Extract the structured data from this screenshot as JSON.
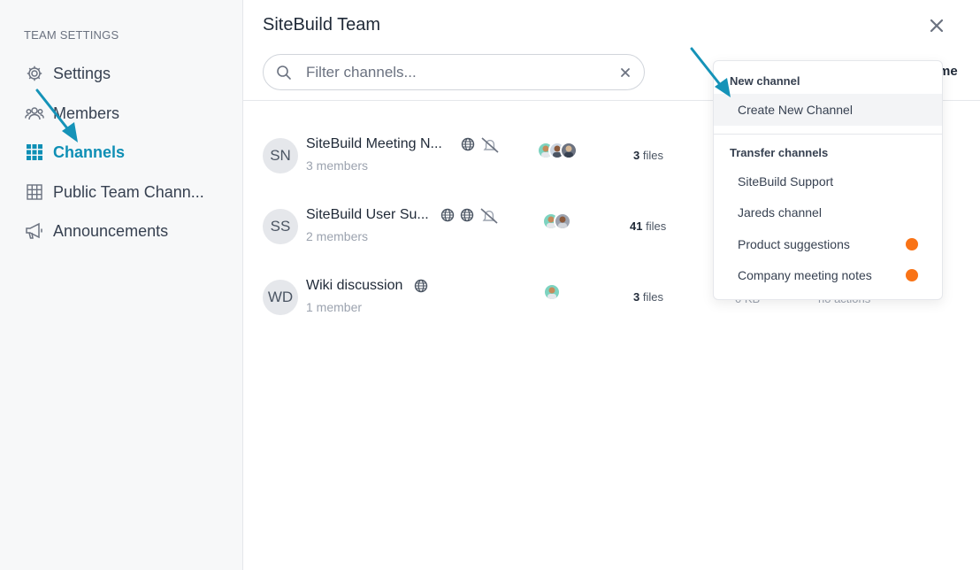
{
  "sidebar": {
    "heading": "TEAM SETTINGS",
    "items": [
      {
        "label": "Settings",
        "icon": "gear-icon"
      },
      {
        "label": "Members",
        "icon": "members-icon"
      },
      {
        "label": "Channels",
        "icon": "grid-icon",
        "active": true
      },
      {
        "label": "Public Team Chann...",
        "icon": "table-icon"
      },
      {
        "label": "Announcements",
        "icon": "megaphone-icon"
      }
    ]
  },
  "main": {
    "title": "SiteBuild Team",
    "search_placeholder": "Filter channels...",
    "header_partial": "me"
  },
  "channels": [
    {
      "initials": "SN",
      "name": "SiteBuild Meeting N...",
      "members": "3 members",
      "files_count": "3",
      "files_label": "files"
    },
    {
      "initials": "SS",
      "name": "SiteBuild User Su...",
      "members": "2 members",
      "files_count": "41",
      "files_label": "files"
    },
    {
      "initials": "WD",
      "name": "Wiki discussion",
      "members": "1 member",
      "files_count": "3",
      "files_label": "files",
      "size": "0 KB",
      "actions": "no actions"
    }
  ],
  "dropdown": {
    "new_heading": "New channel",
    "create_label": "Create New Channel",
    "transfer_heading": "Transfer channels",
    "transfer_items": [
      {
        "label": "SiteBuild Support"
      },
      {
        "label": "Jareds channel"
      },
      {
        "label": "Product suggestions",
        "dot": true
      },
      {
        "label": "Company meeting notes",
        "dot": true
      }
    ]
  },
  "colors": {
    "accent": "#0e8fb5",
    "arrow": "#1593b8",
    "dot": "#f97316"
  }
}
